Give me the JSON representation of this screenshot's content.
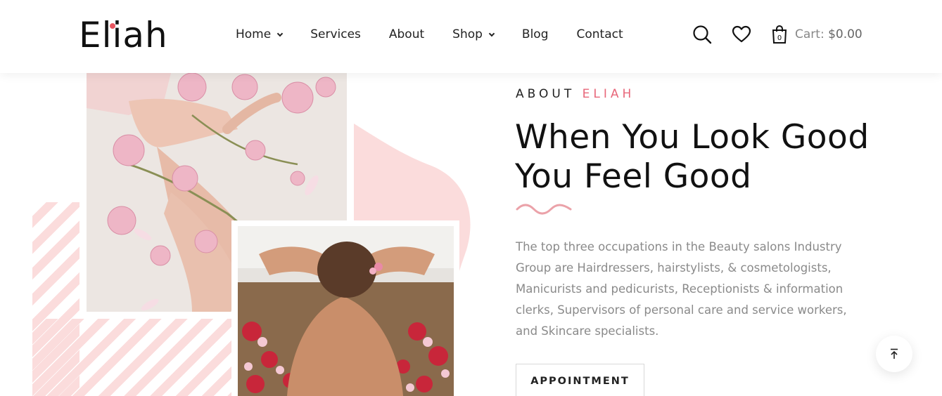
{
  "brand": {
    "name": "Eliah",
    "accent_color": "#e8555f"
  },
  "nav": {
    "items": [
      {
        "label": "Home",
        "has_dropdown": true
      },
      {
        "label": "Services",
        "has_dropdown": false
      },
      {
        "label": "About",
        "has_dropdown": false
      },
      {
        "label": "Shop",
        "has_dropdown": true
      },
      {
        "label": "Blog",
        "has_dropdown": false
      },
      {
        "label": "Contact",
        "has_dropdown": false
      }
    ]
  },
  "header_icons": {
    "search": "search-icon",
    "wishlist": "heart-icon",
    "cart": "shopping-bag-icon"
  },
  "cart": {
    "label": "Cart:",
    "amount": "$0.00",
    "count": "0"
  },
  "about": {
    "eyebrow": "ABOUT",
    "eyebrow_accent": "ELIAH",
    "title_line1": "When You Look Good",
    "title_line2": "You Feel Good",
    "description": "The top three occupations in the Beauty salons Industry Group are Hairdressers, hairstylists, & cosmetologists, Manicurists and pedicurists, Receptionists & information clerks, Supervisors of personal care and service workers, and Skincare specialists.",
    "button_label": "APPOINTMENT"
  },
  "colors": {
    "pink_light": "#fbdcdc",
    "pink_accent": "#e8677a",
    "text_muted": "#8a8a8a"
  },
  "scroll_top_icon": "arrow-up-icon"
}
